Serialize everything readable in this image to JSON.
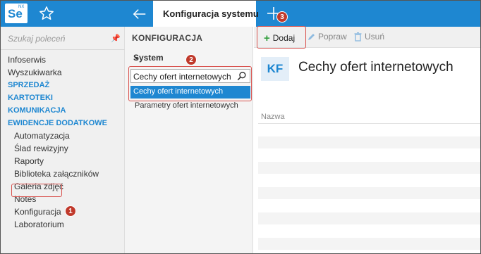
{
  "topbar": {
    "logo_text": "Se",
    "logo_sub": "NX",
    "active_tab": "Konfiguracja systemu"
  },
  "colors": {
    "accent": "#1e87d1",
    "highlight": "#d9534f",
    "badge": "#c0392b",
    "add_green": "#2e9d3a"
  },
  "left": {
    "search_placeholder": "Szukaj poleceń",
    "menu": [
      {
        "label": "Infoserwis",
        "kind": "item"
      },
      {
        "label": "Wyszukiwarka",
        "kind": "item"
      },
      {
        "label": "SPRZEDAŻ",
        "kind": "section"
      },
      {
        "label": "KARTOTEKI",
        "kind": "section"
      },
      {
        "label": "KOMUNIKACJA",
        "kind": "section"
      },
      {
        "label": "EWIDENCJE DODATKOWE",
        "kind": "section"
      },
      {
        "label": "Automatyzacja",
        "kind": "sub"
      },
      {
        "label": "Ślad rewizyjny",
        "kind": "sub"
      },
      {
        "label": "Raporty",
        "kind": "sub"
      },
      {
        "label": "Biblioteka załączników",
        "kind": "sub"
      },
      {
        "label": "Galeria zdjęć",
        "kind": "sub"
      },
      {
        "label": "Notes",
        "kind": "sub"
      },
      {
        "label": "Konfiguracja",
        "kind": "sub"
      },
      {
        "label": "Laboratorium",
        "kind": "sub"
      }
    ]
  },
  "middle": {
    "title": "KONFIGURACJA",
    "select_value": "System",
    "filter_value": "Cechy ofert internetowych",
    "items": [
      "Cechy ofert internetowych",
      "Parametry ofert internetowych"
    ]
  },
  "toolbar": {
    "add": "Dodaj",
    "edit": "Popraw",
    "delete": "Usuń"
  },
  "content": {
    "badge": "KF",
    "title": "Cechy ofert internetowych",
    "column_name": "Nazwa"
  },
  "badges": [
    "1",
    "2",
    "3"
  ]
}
